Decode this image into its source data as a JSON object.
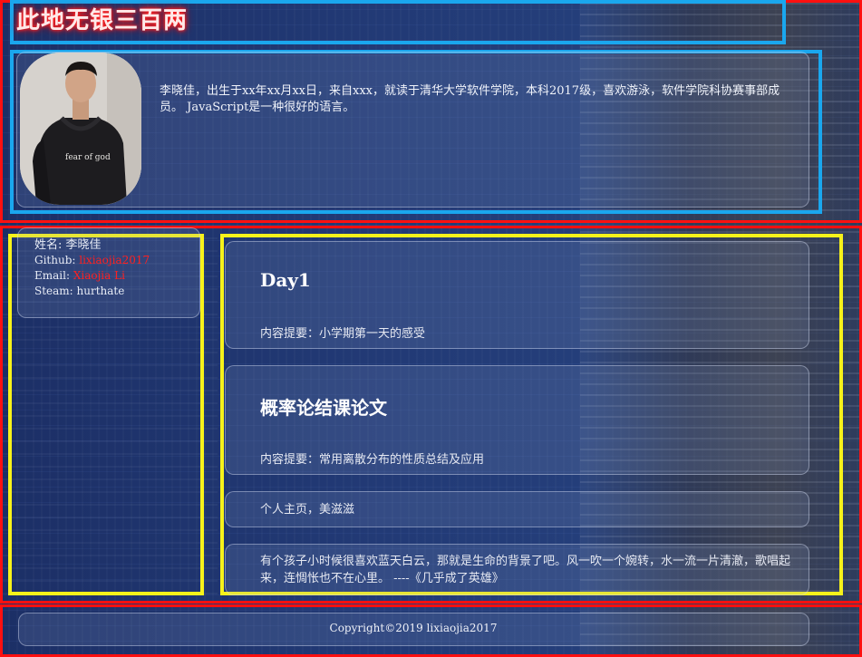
{
  "header": {
    "site_title": "此地无银三百两"
  },
  "profile": {
    "intro": "李晓佳，出生于xx年xx月xx日，来自xxx，就读于清华大学软件学院，本科2017级，喜欢游泳，软件学院科协赛事部成员。 JavaScript是一种很好的语言。",
    "shirt_text": "fear of god"
  },
  "sidebar": {
    "name_line": "姓名: 李晓佳",
    "github_label": "Github: ",
    "github_value": "lixiaojia2017",
    "email_label": "Email: ",
    "email_value": "Xiaojia Li",
    "steam_line": "Steam: hurthate"
  },
  "posts": [
    {
      "title": "Day1",
      "summary": "内容提要：小学期第一天的感受"
    },
    {
      "title": "概率论结课论文",
      "summary": "内容提要：常用离散分布的性质总结及应用"
    }
  ],
  "links_card": {
    "text": "个人主页，美滋滋"
  },
  "quote_card": {
    "text": "有个孩子小时候很喜欢蓝天白云，那就是生命的背景了吧。风一吹一个婉转，水一流一片清澈，歌唱起来，连惆怅也不在心里。 ----《几乎成了英雄》"
  },
  "footer": {
    "copyright": "Copyright©2019 lixiaojia2017"
  },
  "colors": {
    "annotation_red": "#ff1010",
    "annotation_blue": "#1aa7ee",
    "annotation_yellow": "#f7f21a",
    "link_red": "#ff2020"
  }
}
